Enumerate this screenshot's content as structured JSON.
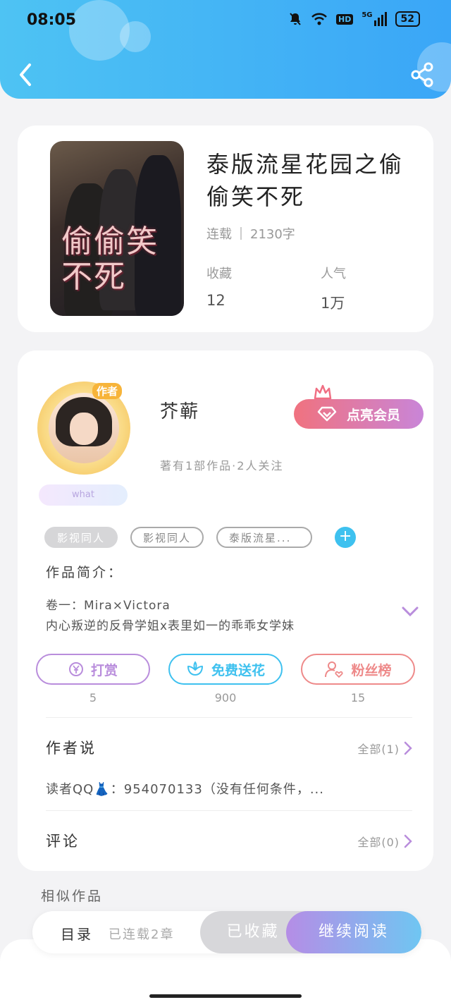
{
  "status_bar": {
    "time": "08:05",
    "network": "5G",
    "hd": "HD",
    "battery": "52"
  },
  "book": {
    "title": "泰版流星花园之偷偷笑不死",
    "cover_text": "偷偷笑不死",
    "status": "连载",
    "word_count": "2130字",
    "stats": [
      {
        "label": "收藏",
        "value": "12"
      },
      {
        "label": "人气",
        "value": "1万"
      }
    ]
  },
  "author": {
    "name": "芥蕲",
    "tag": "作者",
    "badge": "what",
    "stats": "著有1部作品·2人关注",
    "vip_label": "点亮会员",
    "tags": [
      "影视同人",
      "影视同人",
      "泰版流星..."
    ],
    "intro_title": "作品简介：",
    "intro_lines": [
      "卷一：Mira×Victora",
      "内心叛逆的反骨学姐x表里如一的乖乖女学妹"
    ]
  },
  "actions": [
    {
      "label": "打赏",
      "count": "5",
      "color": "#b98ddc"
    },
    {
      "label": "免费送花",
      "count": "900",
      "color": "#3ec1ef"
    },
    {
      "label": "粉丝榜",
      "count": "15",
      "color": "#ee8a8a"
    }
  ],
  "author_says": {
    "title": "作者说",
    "more": "全部(1)",
    "note": "读者QQ👗：954070133（没有任何条件，..."
  },
  "comments": {
    "title": "评论",
    "more": "全部(0)"
  },
  "similar": {
    "title": "相似作品"
  },
  "bottom_bar": {
    "toc": "目录",
    "chapters": "已连载2章",
    "collected": "已收藏",
    "read": "继续阅读"
  }
}
